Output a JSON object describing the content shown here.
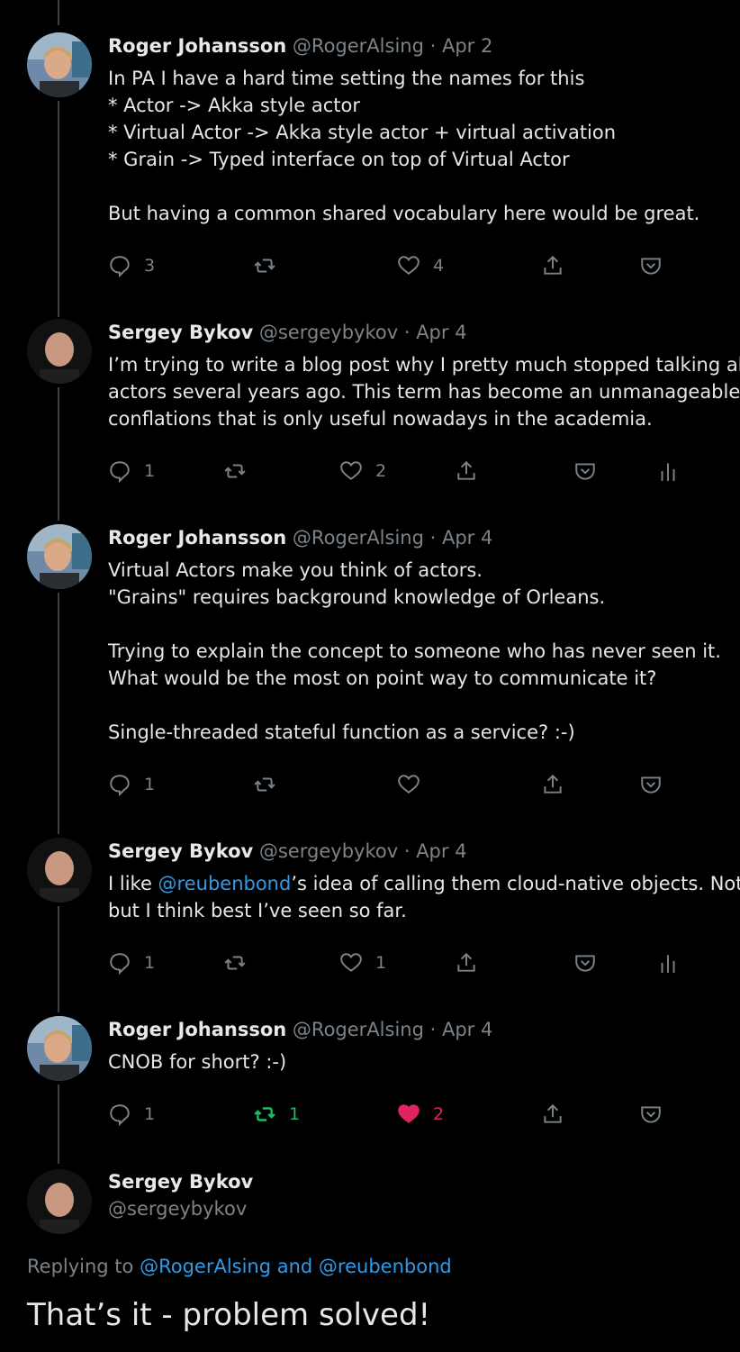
{
  "tweets": [
    {
      "author": "Roger Johansson",
      "handle": "@RogerAlsing",
      "date": "Apr 2",
      "lines": [
        "In PA I have a hard time setting the names for this",
        "* Actor -> Akka style actor",
        "* Virtual Actor -> Akka style actor + virtual activation",
        "* Grain -> Typed interface on top of Virtual Actor",
        "",
        "But having a common shared vocabulary here would be great."
      ],
      "replies": "3",
      "retweets": "",
      "likes": "4"
    },
    {
      "author": "Sergey Bykov",
      "handle": "@sergeybykov",
      "date": "Apr 4",
      "lines": [
        "I’m trying to write a blog post why I pretty much stopped talking about",
        "actors several years ago. This term has become an unmanageable blob",
        "conflations that is only useful nowadays in the academia."
      ],
      "replies": "1",
      "retweets": "",
      "likes": "2"
    },
    {
      "author": "Roger Johansson",
      "handle": "@RogerAlsing",
      "date": "Apr 4",
      "lines": [
        "Virtual Actors make you think of actors.",
        "\"Grains\" requires background knowledge of Orleans.",
        "",
        "Trying to explain the concept to someone who has never seen it.",
        "What would be the most on point way to communicate it?",
        "",
        "Single-threaded stateful function as a service? :-)"
      ],
      "replies": "1",
      "retweets": "",
      "likes": ""
    },
    {
      "author": "Sergey Bykov",
      "handle": "@sergeybykov",
      "date": "Apr 4",
      "line1_pre": "I like ",
      "line1_mention": "@reubenbond",
      "line1_post": "’s idea of calling them cloud-native objects. Not pe",
      "line2": "but I think best I’ve seen so far.",
      "replies": "1",
      "retweets": "",
      "likes": "1"
    },
    {
      "author": "Roger Johansson",
      "handle": "@RogerAlsing",
      "date": "Apr 4",
      "lines": [
        "CNOB for short? :-)"
      ],
      "replies": "1",
      "retweets": "1",
      "likes": "2"
    }
  ],
  "main": {
    "author": "Sergey Bykov",
    "handle": "@sergeybykov",
    "replying_prefix": "Replying to ",
    "replying_mentions": "@RogerAlsing and @reubenbond",
    "text": "That’s it - problem solved!"
  },
  "colors": {
    "background": "#000000",
    "link": "#2f9be8",
    "retweet_active": "#17bf63",
    "like_active": "#e0245e",
    "muted": "#7b8389"
  }
}
